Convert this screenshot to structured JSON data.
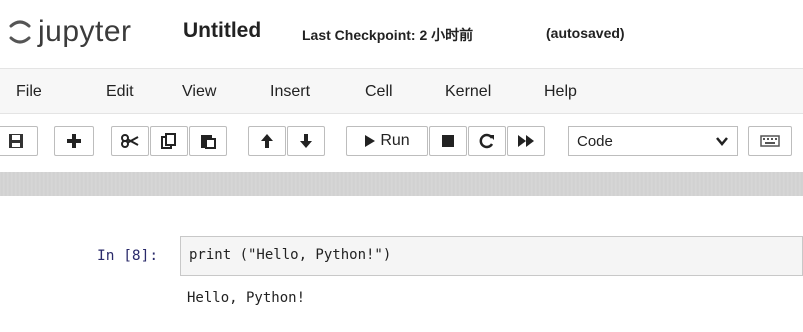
{
  "header": {
    "logo_text": "jupyter",
    "notebook_title": "Untitled",
    "checkpoint_text": "Last Checkpoint: 2 小时前",
    "autosaved_text": "(autosaved)"
  },
  "menu": {
    "items": [
      "File",
      "Edit",
      "View",
      "Insert",
      "Cell",
      "Kernel",
      "Help"
    ]
  },
  "toolbar": {
    "run_label": "Run",
    "cell_type": "Code",
    "icons": [
      "save-icon",
      "plus-icon",
      "cut-icon",
      "copy-icon",
      "paste-icon",
      "arrow-up-icon",
      "arrow-down-icon",
      "play-icon",
      "stop-icon",
      "restart-icon",
      "fast-forward-icon",
      "keyboard-icon"
    ]
  },
  "cell": {
    "prompt": "In [8]:",
    "code": "print (\"Hello, Python!\")",
    "output": "Hello, Python!"
  }
}
